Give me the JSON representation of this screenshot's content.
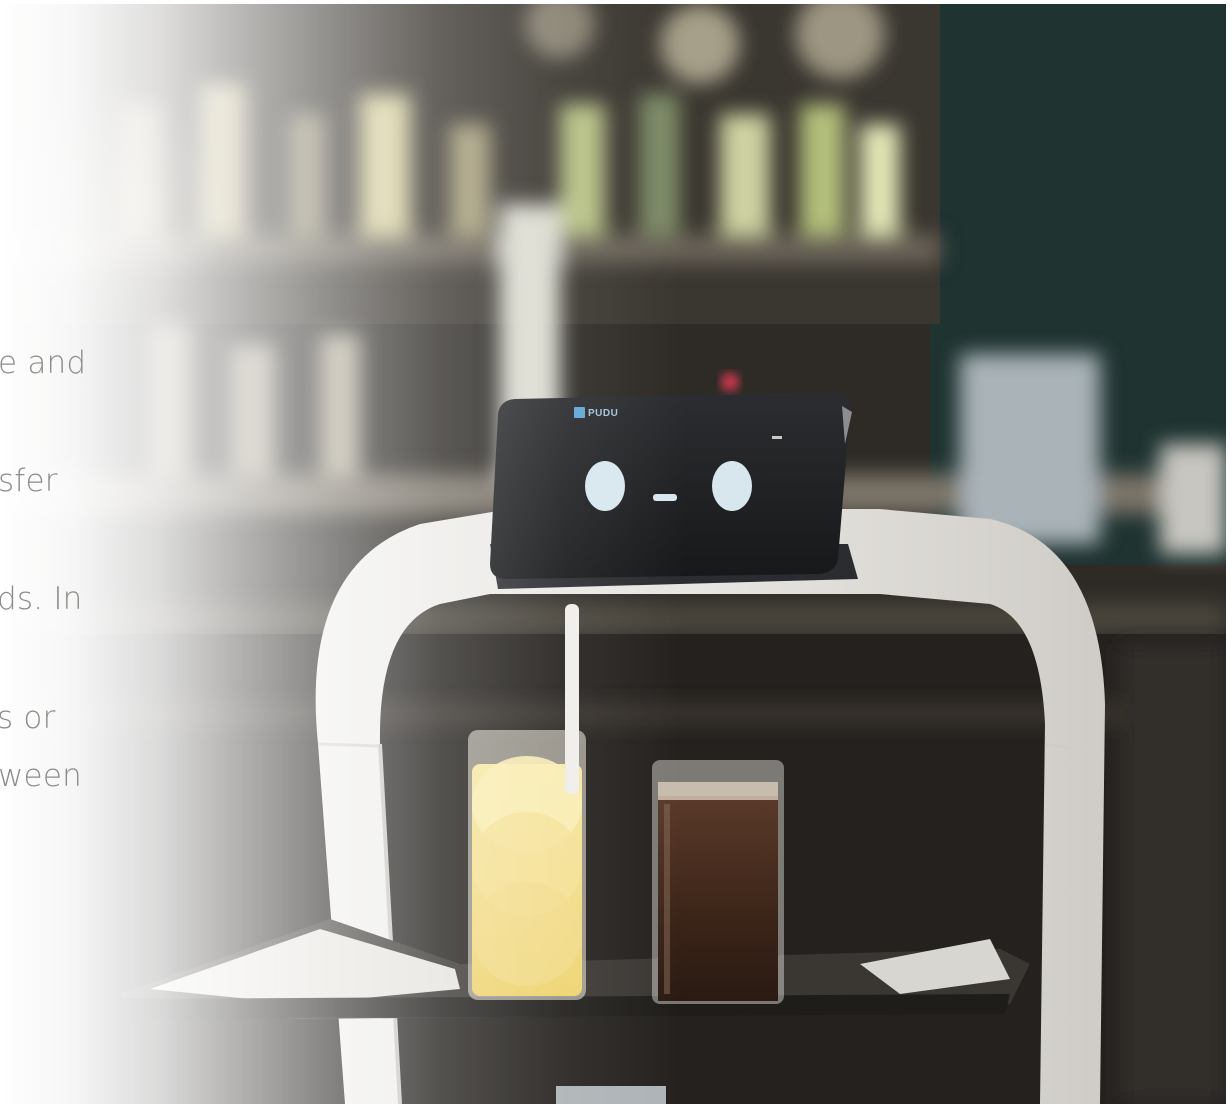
{
  "text_fragments": [
    "e and",
    "sfer",
    "ds. In",
    "s or",
    "ween"
  ],
  "robot_screen": {
    "brand": "PUDU",
    "face": "smiling-eyes-face",
    "accent": "#5fa7d6"
  },
  "colors": {
    "background_dark": "#2a2724",
    "robot_body": "#ecebe8",
    "screen": "#1f2022",
    "text": "#8d8b89"
  }
}
